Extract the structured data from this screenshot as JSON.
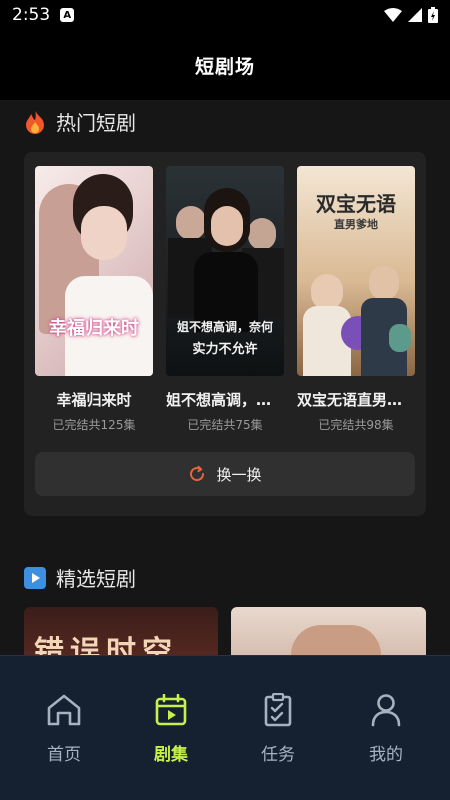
{
  "status": {
    "time": "2:53",
    "notif_glyph": "A"
  },
  "app_bar": {
    "title": "短剧场"
  },
  "hot_section": {
    "title": "热门短剧",
    "icon": "fire-icon",
    "dramas": [
      {
        "name": "幸福归来时",
        "meta": "已完结共125集",
        "poster_text": "幸福归来时"
      },
      {
        "name": "姐不想高调，奈何实力不允许",
        "meta": "已完结共75集",
        "poster_text_1": "姐不想高调，奈何",
        "poster_text_2": "实力不允许"
      },
      {
        "name": "双宝无语直男爹地",
        "meta": "已完结共98集",
        "poster_text_1": "双宝无语",
        "poster_text_2": "直男爹地"
      }
    ],
    "swap_label": "换一换"
  },
  "featured_section": {
    "title": "精选短剧",
    "icon": "play-icon",
    "thumb_text": "错误时空"
  },
  "nav": {
    "items": [
      {
        "label": "首页",
        "icon": "home-icon"
      },
      {
        "label": "剧集",
        "icon": "drama-icon"
      },
      {
        "label": "任务",
        "icon": "task-icon"
      },
      {
        "label": "我的",
        "icon": "profile-icon"
      }
    ],
    "active_index": 1,
    "active_color": "#c7f04a"
  }
}
